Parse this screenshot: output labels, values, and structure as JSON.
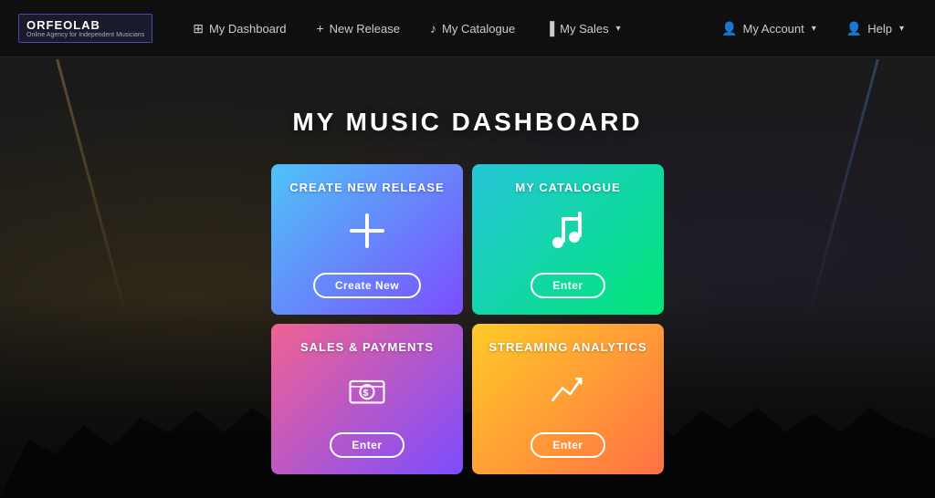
{
  "app": {
    "logo": {
      "title": "ORFEOLAB",
      "subtitle": "Online Agency for Independent Musicians"
    }
  },
  "navbar": {
    "left_items": [
      {
        "id": "dashboard",
        "icon": "grid",
        "label": "My Dashboard"
      },
      {
        "id": "new-release",
        "icon": "plus",
        "label": "New Release"
      },
      {
        "id": "catalogue",
        "icon": "music-note",
        "label": "My Catalogue"
      },
      {
        "id": "sales",
        "icon": "bar-chart",
        "label": "My Sales",
        "has_dropdown": true
      }
    ],
    "right_items": [
      {
        "id": "account",
        "icon": "user",
        "label": "My Account",
        "has_dropdown": true
      },
      {
        "id": "help",
        "icon": "person",
        "label": "Help",
        "has_dropdown": true
      }
    ]
  },
  "page": {
    "title": "MY MUSIC DASHBOARD"
  },
  "cards": [
    {
      "id": "create-new-release",
      "title": "CREATE NEW RELEASE",
      "gradient_class": "card-create",
      "icon_type": "plus",
      "button_label": "Create New",
      "position": "top-left"
    },
    {
      "id": "my-catalogue",
      "title": "MY CATALOGUE",
      "gradient_class": "card-catalogue",
      "icon_type": "music",
      "button_label": "Enter",
      "position": "top-right"
    },
    {
      "id": "sales-payments",
      "title": "SALES & PAYMENTS",
      "gradient_class": "card-sales",
      "icon_type": "money",
      "button_label": "Enter",
      "position": "bottom-left"
    },
    {
      "id": "streaming-analytics",
      "title": "STREAMING ANALYTICS",
      "gradient_class": "card-analytics",
      "icon_type": "chart",
      "button_label": "Enter",
      "position": "bottom-right"
    }
  ]
}
